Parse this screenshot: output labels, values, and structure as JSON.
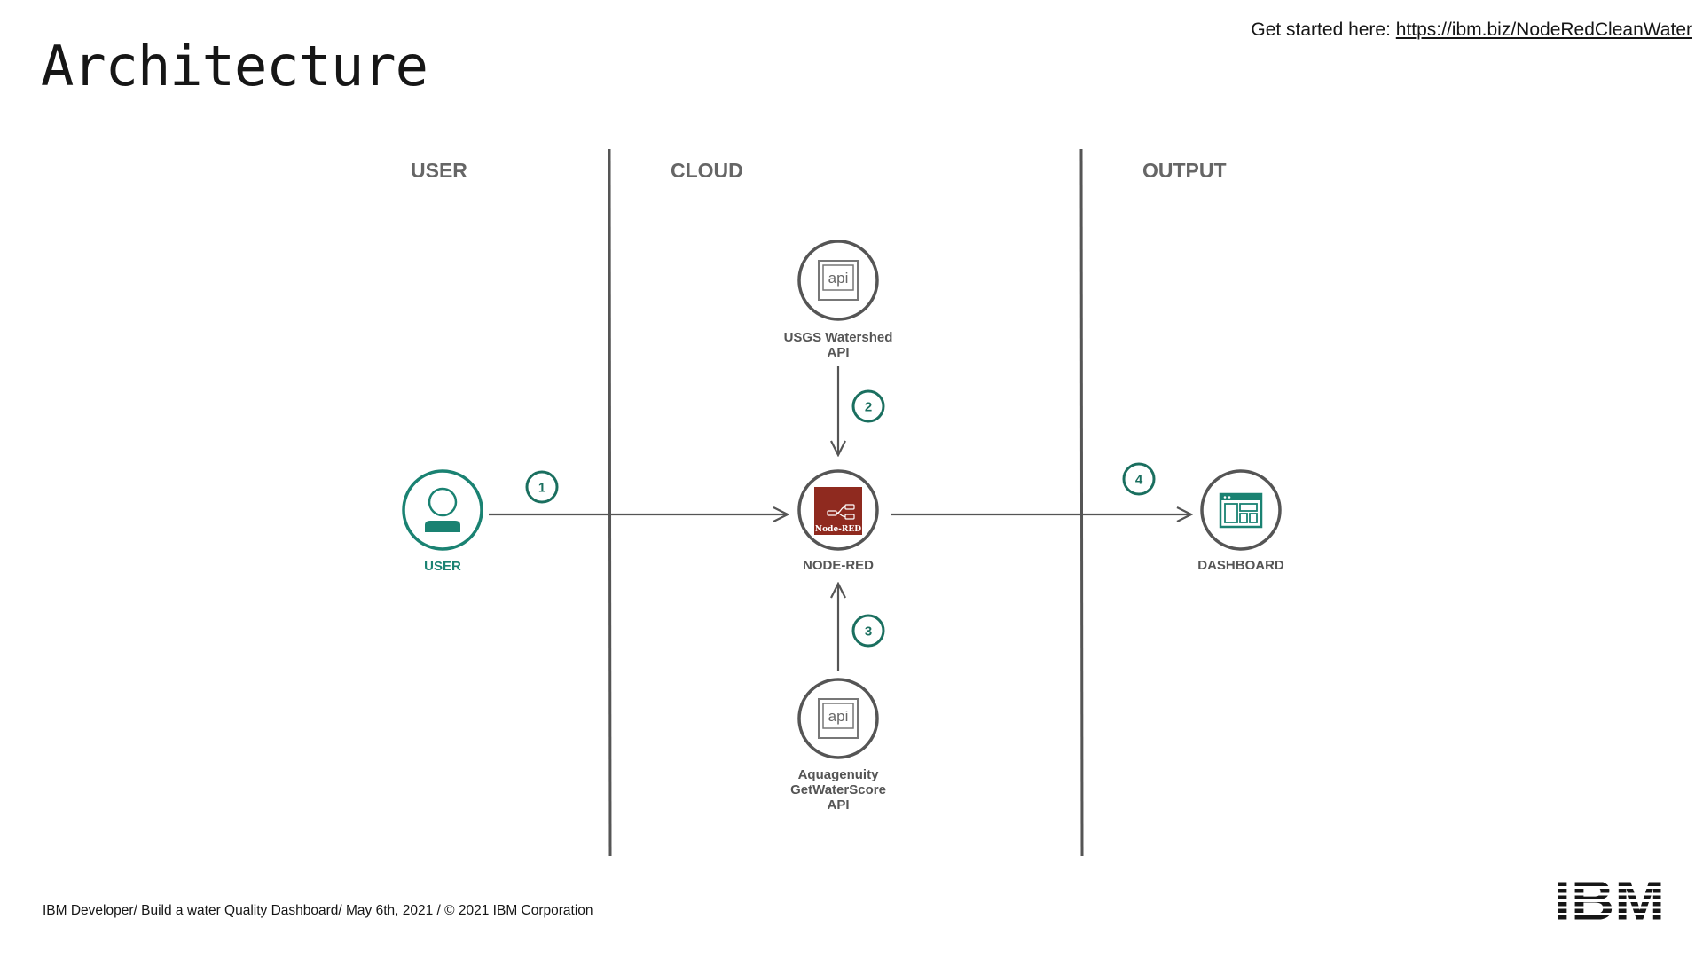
{
  "title": "Architecture",
  "get_started": {
    "prefix": "Get started here: ",
    "link_text": "https://ibm.biz/NodeRedCleanWater"
  },
  "sections": {
    "user": "USER",
    "cloud": "CLOUD",
    "output": "OUTPUT"
  },
  "nodes": {
    "user": {
      "label": "USER"
    },
    "usgs_api": {
      "icon_text": "api",
      "label_lines": [
        "USGS Watershed",
        "API"
      ]
    },
    "node_red": {
      "logo_text": "Node-RED",
      "label": "NODE-RED"
    },
    "aquagenuity_api": {
      "icon_text": "api",
      "label_lines": [
        "Aquagenuity",
        "GetWaterScore",
        "API"
      ]
    },
    "dashboard": {
      "label": "DASHBOARD"
    }
  },
  "steps": [
    "1",
    "2",
    "3",
    "4"
  ],
  "colors": {
    "accent_green": "#1a8272",
    "step_green": "#1a6f5f",
    "node_red": "#8f2a1f",
    "gray": "#666666"
  },
  "footer": "IBM Developer/ Build a water Quality Dashboard/ May 6th, 2021 / © 2021 IBM Corporation",
  "logo": "IBM"
}
